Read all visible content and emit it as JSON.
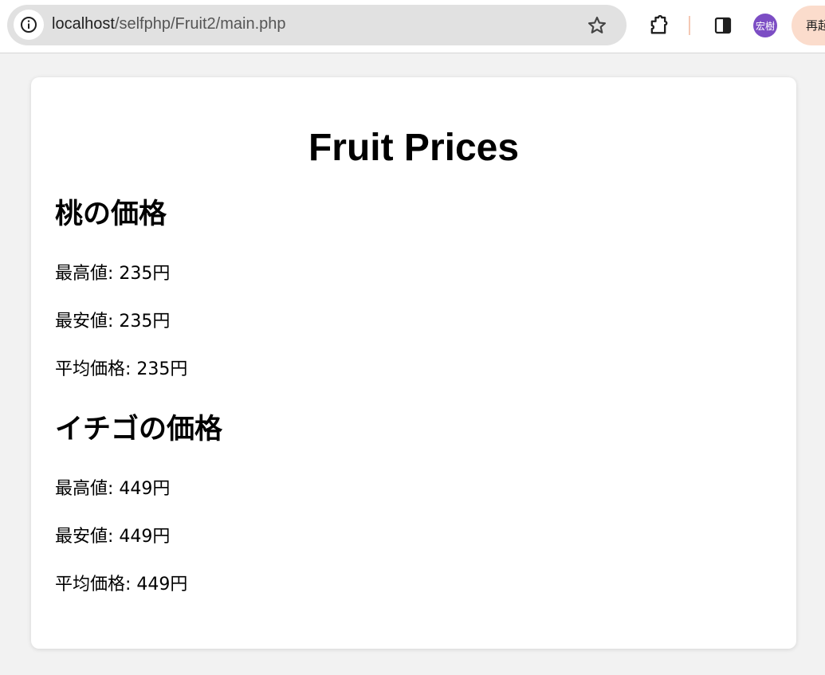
{
  "browser": {
    "url_host": "localhost",
    "url_path": "/selfphp/Fruit2/main.php",
    "avatar_label": "宏樹",
    "relaunch_label": "再起動",
    "icons": [
      "info-icon",
      "star-icon",
      "extensions-icon",
      "side-panel-icon"
    ]
  },
  "page": {
    "title": "Fruit Prices",
    "sections": [
      {
        "heading": "桃の価格",
        "max": "最高値: 235円",
        "min": "最安値: 235円",
        "avg": "平均価格: 235円"
      },
      {
        "heading": "イチゴの価格",
        "max": "最高値: 449円",
        "min": "最安値: 449円",
        "avg": "平均価格: 449円"
      }
    ]
  },
  "colors": {
    "page_background": "#f2f2f2",
    "card_background": "#ffffff",
    "avatar": "#7c4dc4",
    "relaunch_button": "#fbdccc"
  }
}
